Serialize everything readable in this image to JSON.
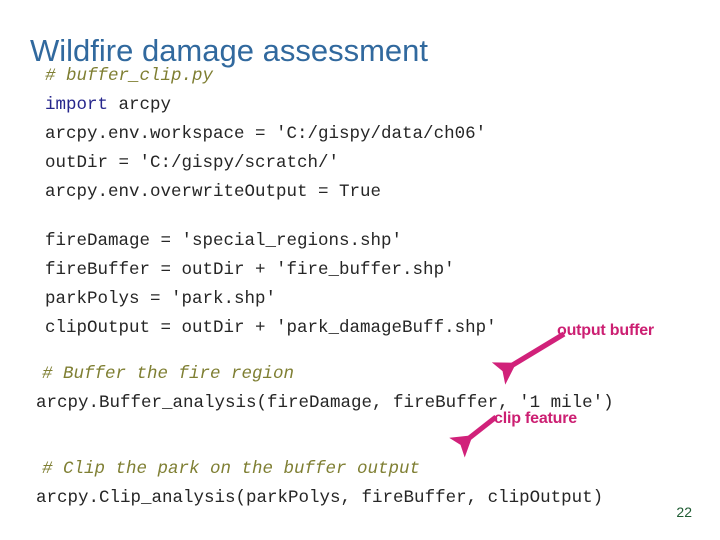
{
  "slide": {
    "title": "Wildfire damage assessment",
    "page_number": "22",
    "colors": {
      "title": "#31699e",
      "comment": "#7f7f33",
      "keyword": "#26268c",
      "code": "#262626",
      "annotation": "#cc1f72",
      "page_number": "#1f5c33",
      "background": "#ffffff"
    }
  },
  "code": {
    "block1": {
      "line1_comment": "# buffer_clip.py",
      "line2_keyword": "import",
      "line2_rest": " arcpy",
      "line3": "arcpy.env.workspace = 'C:/gispy/data/ch06'",
      "line4": "outDir = 'C:/gispy/scratch/'",
      "line5": "arcpy.env.overwriteOutput = True"
    },
    "block2": {
      "line1": "fireDamage = 'special_regions.shp'",
      "line2": "fireBuffer = outDir + 'fire_buffer.shp'",
      "line3": "parkPolys = 'park.shp'",
      "line4": "clipOutput = outDir + 'park_damageBuff.shp'"
    },
    "block3": {
      "comment": "# Buffer the fire region",
      "statement": "arcpy.Buffer_analysis(fireDamage, fireBuffer, '1 mile')"
    },
    "block4": {
      "comment": "# Clip the park on the buffer output",
      "statement": "arcpy.Clip_analysis(parkPolys, fireBuffer, clipOutput)"
    }
  },
  "annotations": [
    {
      "id": "output-buffer",
      "label": "output buffer"
    },
    {
      "id": "clip-feature",
      "label": "clip feature"
    }
  ]
}
